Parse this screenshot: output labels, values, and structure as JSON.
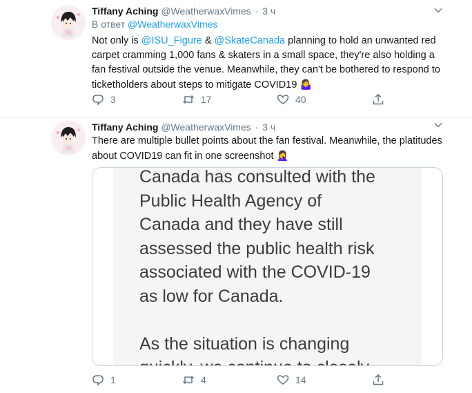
{
  "tweets": [
    {
      "name": "Tiffany Aching",
      "handle": "@WeatherwaxVimes",
      "separator": "·",
      "time": "3 ч",
      "reply_prefix": "В ответ",
      "reply_handle": "@WeatherwaxVimes",
      "text": {
        "p1": "Not only is ",
        "mention1": "@ISU_Figure",
        "p2": " & ",
        "mention2": "@SkateCanada",
        "p3": " planning to hold an unwanted red carpet cramming 1,000 fans & skaters  in a small space, they're also holding a fan festival outside the venue. Meanwhile, they can't be bothered to respond to ticketholders about steps to mitigate COVID19 ",
        "emoji": "🤷‍♀️"
      },
      "stats": {
        "replies": "3",
        "retweets": "17",
        "likes": "40"
      },
      "icons": {
        "reply": "reply-icon",
        "retweet": "retweet-icon",
        "like": "heart-icon",
        "share": "share-icon",
        "more": "chevron-down-icon",
        "avatar": "avatar-illustration"
      }
    },
    {
      "name": "Tiffany Aching",
      "handle": "@WeatherwaxVimes",
      "separator": "·",
      "time": "3 ч",
      "text": {
        "body": "There are multiple bullet points about the fan festival. Meanwhile, the platitudes about COVID19 can fit in one screenshot ",
        "emoji": "🤦‍♀️"
      },
      "media_text": "Canada has consulted with the\nPublic Health Agency of\nCanada and they have still\nassessed the public health risk\nassociated with the COVID-19\nas low for Canada.\n\nAs the situation is changing\nquickly, we continue to closely",
      "stats": {
        "replies": "1",
        "retweets": "4",
        "likes": "14"
      },
      "icons": {
        "reply": "reply-icon",
        "retweet": "retweet-icon",
        "like": "heart-icon",
        "share": "share-icon",
        "more": "chevron-down-icon",
        "avatar": "avatar-illustration"
      }
    }
  ],
  "colors": {
    "link": "#1da1f2",
    "muted": "#657786",
    "text": "#14171a",
    "border": "#e6ecf0"
  }
}
